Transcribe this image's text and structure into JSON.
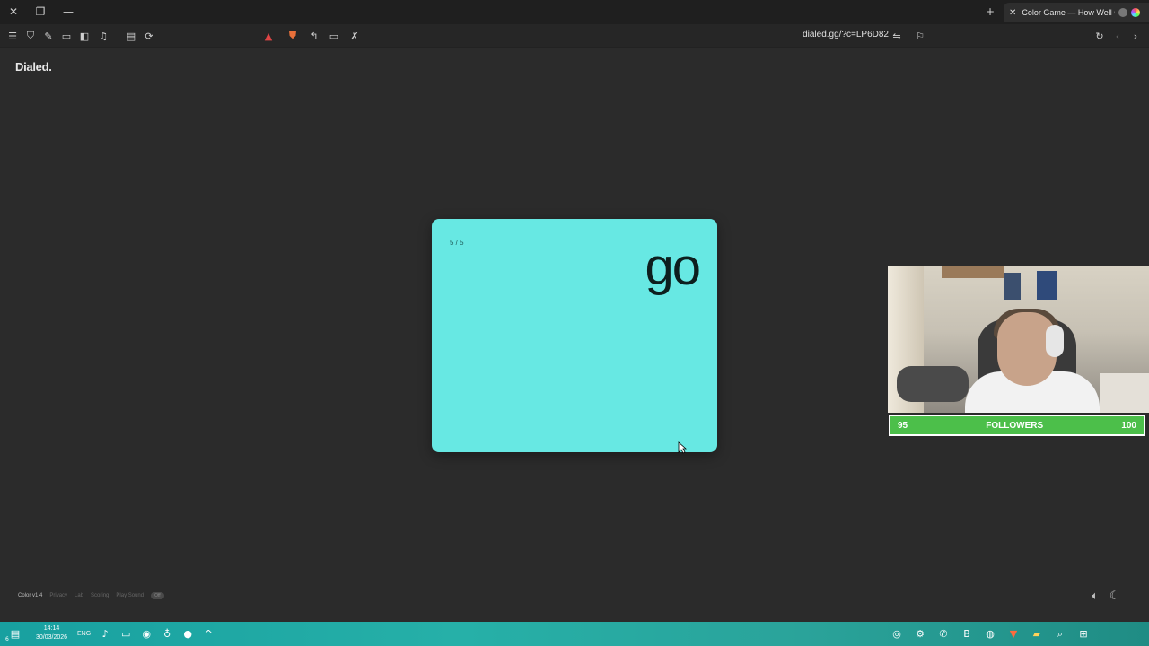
{
  "browser": {
    "tab_title": "Color Game — How Well Can",
    "url": "dialed.gg/?c=LP6D82"
  },
  "page": {
    "brand": "Dialed.",
    "card": {
      "counter": "5 / 5",
      "word": "go",
      "color": "#67e8e3"
    },
    "footer": {
      "version": "Color v1.4",
      "links": [
        "Privacy",
        "Lab",
        "Scoring",
        "Play Sound"
      ],
      "sound_pill": "Off"
    }
  },
  "overlay": {
    "followers": {
      "current": "95",
      "label": "FOLLOWERS",
      "goal": "100"
    }
  },
  "taskbar": {
    "badge": "6",
    "time": "14:14",
    "date": "30/03/2026",
    "lang": "ENG"
  }
}
